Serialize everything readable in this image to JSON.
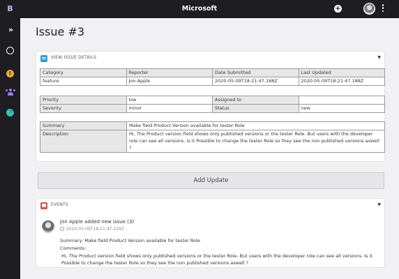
{
  "app": {
    "window_title": "Microsoft",
    "brand_letter": "B"
  },
  "page": {
    "title": "Issue #3"
  },
  "details": {
    "header": "VIEW ISSUE DETAILS",
    "row1_headers": [
      "Category",
      "Reporter",
      "Date Submitted",
      "Last Updated"
    ],
    "row1_values": [
      "feature",
      "Jon Apple",
      "2020-05-09T18:21:47.188Z",
      "2020-05-09T18:21:47.188Z"
    ],
    "priority_label": "Priority",
    "priority_value": "low",
    "assigned_label": "Assigned to",
    "assigned_value": "",
    "severity_label": "Severity",
    "severity_value": "minor",
    "status_label": "Status",
    "status_value": "new",
    "summary_label": "Summary",
    "summary_value": "Make field Product Version available for tester Role",
    "description_label": "Description",
    "description_value": "Hi, The Product version field shows only published versions or the tester Role. But users with the developer role can see all versions. Is it Possible to change the tester Role so they see the non published versions aswell ?"
  },
  "actions": {
    "add_update_label": "Add Update"
  },
  "events": {
    "header": "EVENTS",
    "items": [
      {
        "title": "Jon Apple added new issue (3)",
        "timestamp": "2020-05-09T18:21:47.229Z",
        "summary": "Summary: Make field Product Version available for tester Role",
        "comments_label": "Comments:",
        "comments": "Hi, The Product version field shows only published versions or the tester Role. But users with the developer role can see all versions. Is it Possible to change the tester Role so they see the non published versions aswell ?"
      }
    ]
  },
  "icons": {
    "sidebar": [
      "chevrons-right-icon",
      "circle-icon",
      "alert-icon",
      "users-icon",
      "pie-chart-icon"
    ],
    "topbar": [
      "plus-circle-icon",
      "user-avatar",
      "kebab-menu-icon"
    ]
  },
  "colors": {
    "topbar_bg": "#1e1e22",
    "page_bg": "#f1f1f4",
    "brand": "#c6b4f5",
    "alert": "#f0a83a",
    "users": "#9b7cf0",
    "chart": "#2aa198",
    "details_icon": "#2f9fd0",
    "events_icon": "#e74c3c",
    "link": "#5b4bd2"
  }
}
